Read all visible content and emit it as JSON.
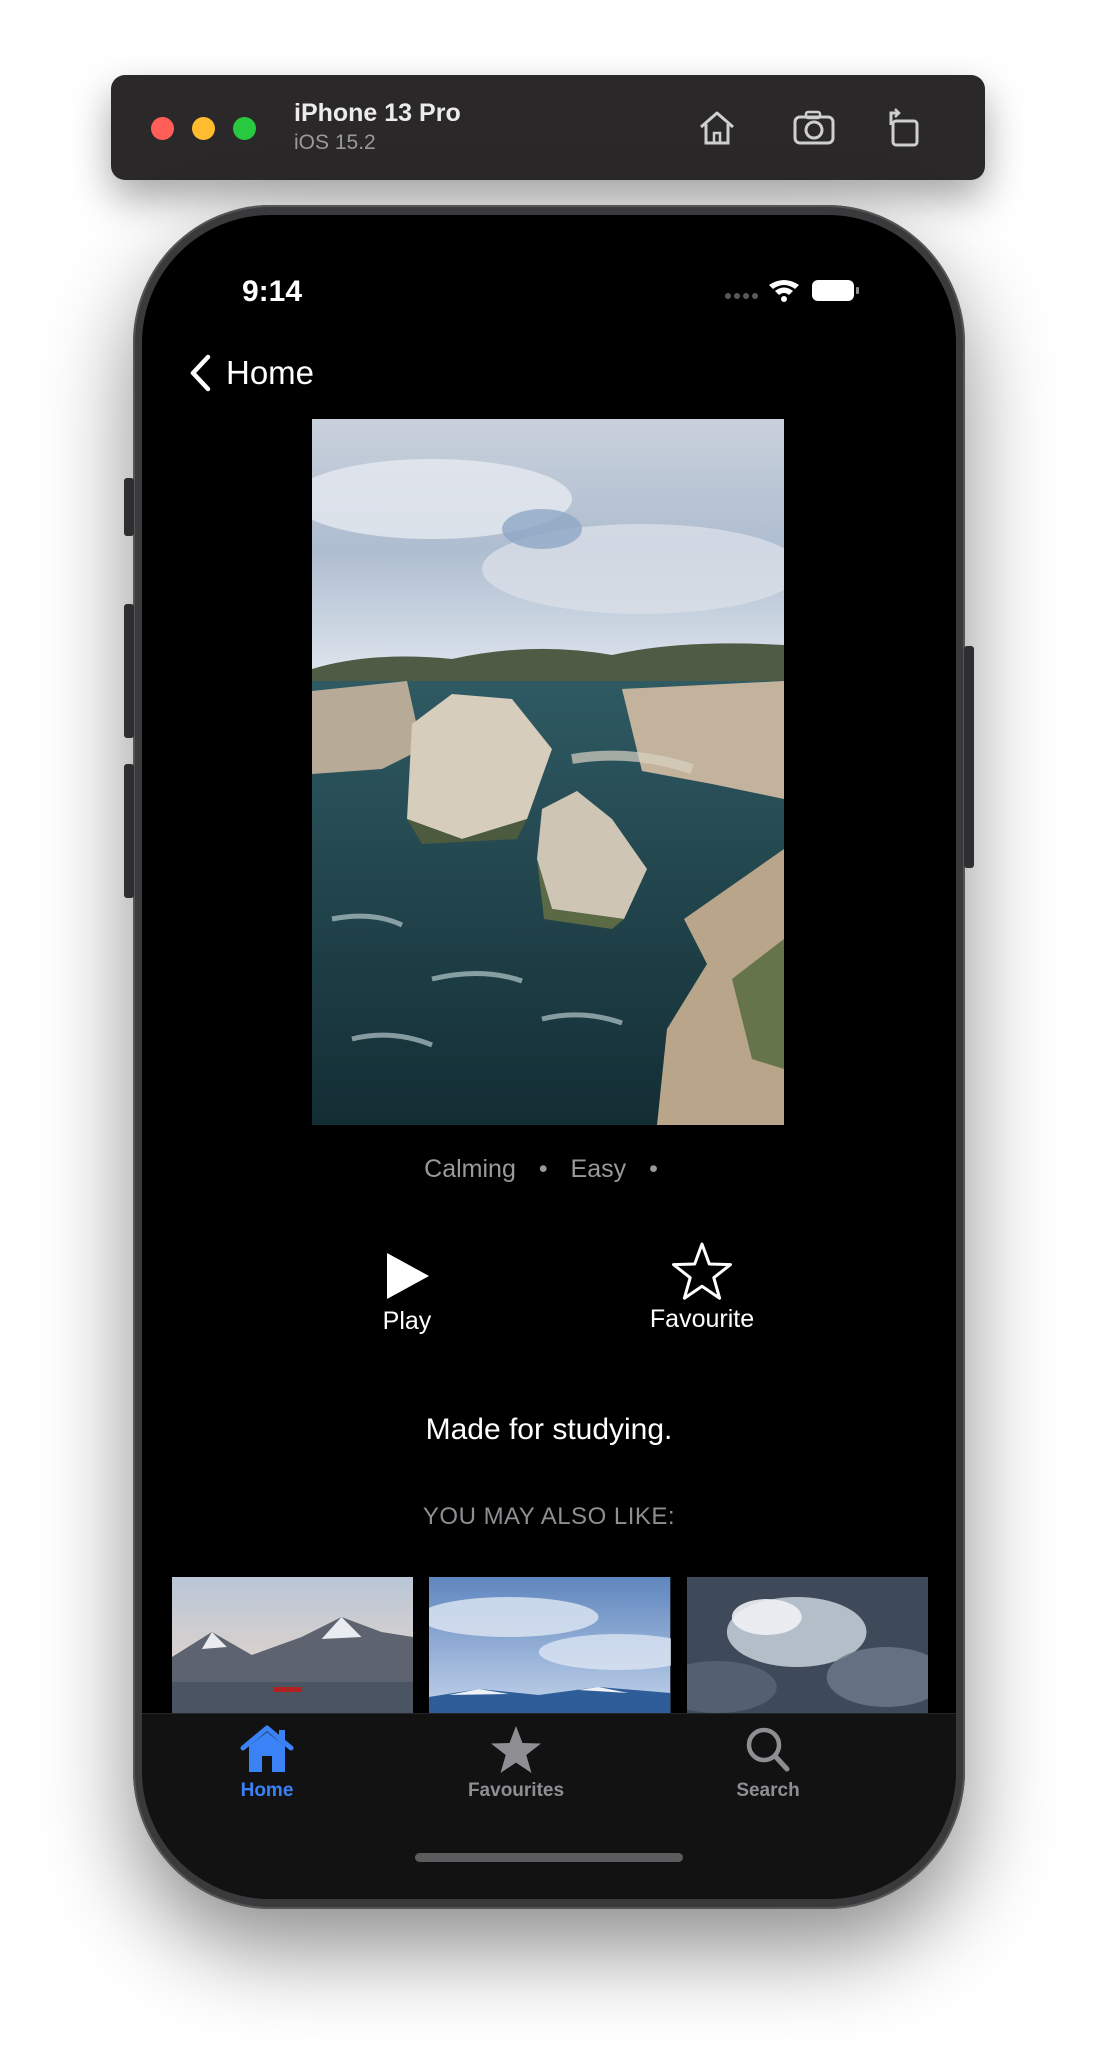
{
  "simulator": {
    "device_name": "iPhone 13 Pro",
    "os_version": "iOS 15.2",
    "toolbar_icons": [
      "home-icon",
      "screenshot-icon",
      "rotate-icon"
    ]
  },
  "status_bar": {
    "time": "9:14",
    "icons": [
      "cellular-icon",
      "wifi-icon",
      "battery-icon"
    ]
  },
  "nav": {
    "back_label": "Home"
  },
  "meditation": {
    "tags": [
      "Calming",
      "Easy"
    ],
    "separator": "•",
    "description": "Made for studying."
  },
  "actions": {
    "play_label": "Play",
    "favourite_label": "Favourite"
  },
  "recommendations": {
    "heading": "YOU MAY ALSO LIKE:"
  },
  "tabbar": {
    "tabs": [
      {
        "label": "Home",
        "icon": "house-icon",
        "active": true
      },
      {
        "label": "Favourites",
        "icon": "star-icon",
        "active": false
      },
      {
        "label": "Search",
        "icon": "magnifier-icon",
        "active": false
      }
    ]
  },
  "colors": {
    "accent": "#3b82f6",
    "background": "#000000",
    "secondary_text": "#8e8e93"
  }
}
